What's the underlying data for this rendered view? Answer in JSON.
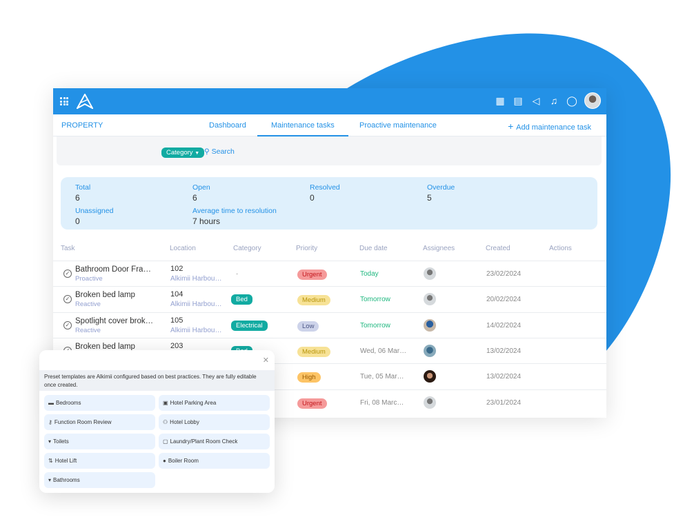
{
  "colors": {
    "brand": "#2391e6",
    "blob": "#2391e6",
    "category": "#12aba2"
  },
  "header": {
    "icons": [
      "apps-grid-icon",
      "logo",
      "calendar-icon",
      "report-icon",
      "megaphone-icon",
      "bell-icon",
      "chat-icon",
      "user-avatar"
    ]
  },
  "nav": {
    "section": "PROPERTY",
    "tabs": [
      {
        "label": "Dashboard"
      },
      {
        "label": "Maintenance tasks",
        "active": true
      },
      {
        "label": "Proactive maintenance"
      }
    ],
    "add_label": "Add maintenance task"
  },
  "filters": {
    "category": "Category",
    "search": "Search"
  },
  "stats": {
    "total": {
      "label": "Total",
      "value": "6"
    },
    "open": {
      "label": "Open",
      "value": "6"
    },
    "resolved": {
      "label": "Resolved",
      "value": "0"
    },
    "overdue": {
      "label": "Overdue",
      "value": "5"
    },
    "unassigned": {
      "label": "Unassigned",
      "value": "0"
    },
    "avg": {
      "label": "Average time to resolution",
      "value": "7 hours"
    }
  },
  "table": {
    "columns": [
      "Task",
      "Location",
      "Category",
      "Priority",
      "Due date",
      "Assignees",
      "Created",
      "Actions"
    ],
    "rows": [
      {
        "task": "Bathroom Door Frame...",
        "type": "Proactive",
        "loc": "102",
        "site": "Alkimii Harbour...",
        "category": "-",
        "priority": "Urgent",
        "due": "Today",
        "created": "23/02/2024"
      },
      {
        "task": "Broken bed lamp",
        "type": "Reactive",
        "loc": "104",
        "site": "Alkimii Harbour...",
        "category": "Bed",
        "priority": "Medium",
        "due": "Tomorrow",
        "created": "20/02/2024"
      },
      {
        "task": "Spotlight cover broken...",
        "type": "Reactive",
        "loc": "105",
        "site": "Alkimii Harbour...",
        "category": "Electrical",
        "priority": "Low",
        "due": "Tomorrow",
        "created": "14/02/2024"
      },
      {
        "task": "Broken bed lamp",
        "type": "",
        "loc": "203",
        "site": "",
        "category": "Bed",
        "priority": "Medium",
        "due": "Wed, 06 March...",
        "created": "13/02/2024"
      },
      {
        "task": "",
        "type": "",
        "loc": "",
        "site": "",
        "category": "",
        "priority": "High",
        "due": "Tue, 05 March...",
        "created": "13/02/2024"
      },
      {
        "task": "",
        "type": "",
        "loc": "",
        "site": "",
        "category": "",
        "priority": "Urgent",
        "due": "Fri, 08 March ...",
        "created": "23/01/2024"
      }
    ]
  },
  "popup": {
    "note": "Preset templates are Alkimii configured based on best practices. They are fully editable once created.",
    "templates": [
      {
        "label": "Bedrooms",
        "icon": "bed-icon"
      },
      {
        "label": "Hotel Parking Area",
        "icon": "car-icon"
      },
      {
        "label": "Function Room Review",
        "icon": "key-icon"
      },
      {
        "label": "Hotel Lobby",
        "icon": "people-icon"
      },
      {
        "label": "Toilets",
        "icon": "toilet-icon"
      },
      {
        "label": "Laundry/Plant Room Check",
        "icon": "washer-icon"
      },
      {
        "label": "Hotel Lift",
        "icon": "lift-icon"
      },
      {
        "label": "Boiler Room",
        "icon": "fire-icon"
      },
      {
        "label": "Bathrooms",
        "icon": "toilet-icon"
      }
    ]
  }
}
